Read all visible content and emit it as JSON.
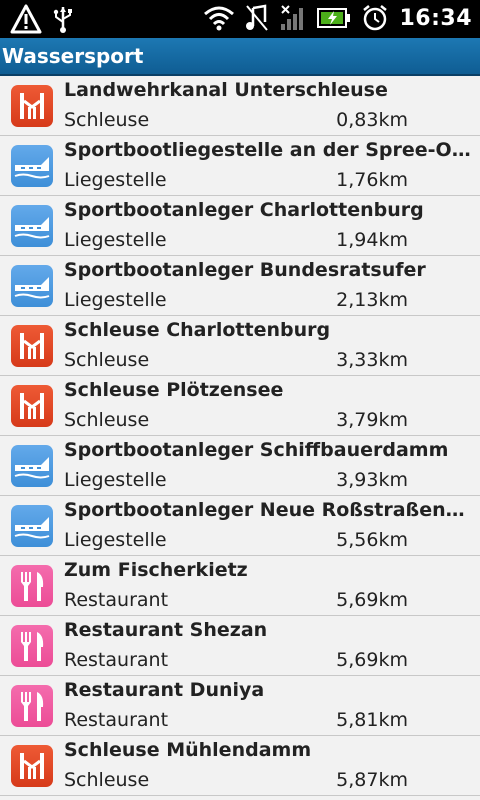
{
  "status_bar": {
    "time": "16:34",
    "icons": [
      "warning-icon",
      "usb-icon",
      "wifi-icon",
      "music-off-icon",
      "signal-off-icon",
      "battery-charging-icon",
      "alarm-icon"
    ]
  },
  "title": "Wassersport",
  "colors": {
    "lock": "#d63a1a",
    "berth": "#3e8fd8",
    "restaurant": "#ec4c96",
    "titlebar": "#1567a3"
  },
  "items": [
    {
      "name": "Landwehrkanal Unterschleuse",
      "type": "Schleuse",
      "distance": "0,83km",
      "icon": "lock-icon"
    },
    {
      "name": "Sportbootliegestelle an der Spree-Oder-Wasserstraße",
      "type": "Liegestelle",
      "distance": "1,76km",
      "icon": "berth-icon"
    },
    {
      "name": "Sportbootanleger Charlottenburg",
      "type": "Liegestelle",
      "distance": "1,94km",
      "icon": "berth-icon"
    },
    {
      "name": "Sportbootanleger Bundesratsufer",
      "type": "Liegestelle",
      "distance": "2,13km",
      "icon": "berth-icon"
    },
    {
      "name": "Schleuse Charlottenburg",
      "type": "Schleuse",
      "distance": "3,33km",
      "icon": "lock-icon"
    },
    {
      "name": "Schleuse Plötzensee",
      "type": "Schleuse",
      "distance": "3,79km",
      "icon": "lock-icon"
    },
    {
      "name": "Sportbootanleger Schiffbauerdamm",
      "type": "Liegestelle",
      "distance": "3,93km",
      "icon": "berth-icon"
    },
    {
      "name": "Sportbootanleger Neue Roßstraßenbrücke",
      "type": "Liegestelle",
      "distance": "5,56km",
      "icon": "berth-icon"
    },
    {
      "name": "Zum Fischerkietz",
      "type": "Restaurant",
      "distance": "5,69km",
      "icon": "restaurant-icon"
    },
    {
      "name": "Restaurant Shezan",
      "type": "Restaurant",
      "distance": "5,69km",
      "icon": "restaurant-icon"
    },
    {
      "name": "Restaurant Duniya",
      "type": "Restaurant",
      "distance": "5,81km",
      "icon": "restaurant-icon"
    },
    {
      "name": "Schleuse Mühlendamm",
      "type": "Schleuse",
      "distance": "5,87km",
      "icon": "lock-icon"
    }
  ]
}
